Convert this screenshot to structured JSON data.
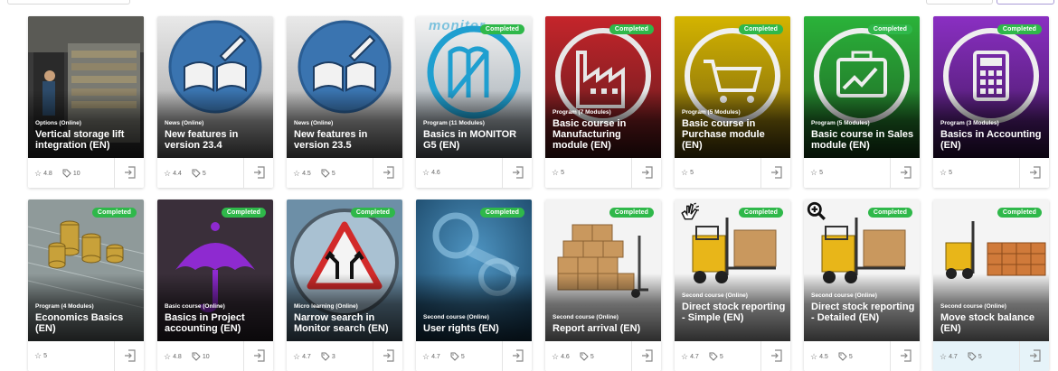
{
  "colors": {
    "completed_badge": "#2fb84a",
    "monitor_blue": "#2a6ba0"
  },
  "row1": [
    {
      "category": "Options (Online)",
      "title": "Vertical storage lift integration (EN)",
      "rating": "4.8",
      "tags": "10",
      "completed": "",
      "image": "warehouse-lift-photo"
    },
    {
      "category": "News (Online)",
      "title": "New features in version 23.4",
      "rating": "4.4",
      "tags": "5",
      "completed": "",
      "image": "open-book-icon"
    },
    {
      "category": "News (Online)",
      "title": "New features in version 23.5",
      "rating": "4.5",
      "tags": "5",
      "completed": "",
      "image": "open-book-icon"
    },
    {
      "category": "Program (11 Modules)",
      "title": "Basics in MONITOR G5 (EN)",
      "rating": "4.6",
      "tags": "",
      "completed": "Completed",
      "image": "monitor-logo-icon",
      "watermark": "monitor"
    },
    {
      "category": "Program (7 Modules)",
      "title": "Basic course in Manufacturing module (EN)",
      "rating": "5",
      "tags": "",
      "completed": "Completed",
      "image": "factory-icon"
    },
    {
      "category": "Program (5 Modules)",
      "title": "Basic course in Purchase module (EN)",
      "rating": "5",
      "tags": "",
      "completed": "Completed",
      "image": "shopping-cart-icon"
    },
    {
      "category": "Program (5 Modules)",
      "title": "Basic course in Sales module (EN)",
      "rating": "5",
      "tags": "",
      "completed": "Completed",
      "image": "briefcase-chart-icon"
    },
    {
      "category": "Program (3 Modules)",
      "title": "Basics in Accounting (EN)",
      "rating": "5",
      "tags": "",
      "completed": "Completed",
      "image": "calculator-icon"
    }
  ],
  "row2": [
    {
      "category": "Program (4 Modules)",
      "title": "Economics Basics (EN)",
      "rating": "5",
      "tags": "",
      "completed": "Completed",
      "image": "coins-photo"
    },
    {
      "category": "Basic course (Online)",
      "title": "Basics in Project accounting (EN)",
      "rating": "4.8",
      "tags": "10",
      "completed": "Completed",
      "image": "umbrella-icon"
    },
    {
      "category": "Micro learning (Online)",
      "title": "Narrow search in Monitor search (EN)",
      "rating": "4.7",
      "tags": "3",
      "completed": "Completed",
      "image": "road-sign-photo"
    },
    {
      "category": "Second course (Online)",
      "title": "User rights (EN)",
      "rating": "4.7",
      "tags": "5",
      "completed": "Completed",
      "image": "keys-photo"
    },
    {
      "category": "Second course (Online)",
      "title": "Report arrival (EN)",
      "rating": "4.6",
      "tags": "5",
      "completed": "Completed",
      "image": "boxes-trolley-photo"
    },
    {
      "category": "Second course (Online)",
      "title": "Direct stock reporting - Simple (EN)",
      "rating": "4.7",
      "tags": "5",
      "completed": "Completed",
      "image": "forklift-photo",
      "corner_icon": "peace-hand-icon"
    },
    {
      "category": "Second course (Online)",
      "title": "Direct stock reporting - Detailed (EN)",
      "rating": "4.5",
      "tags": "5",
      "completed": "Completed",
      "image": "forklift-photo",
      "corner_icon": "magnifier-plus-icon"
    },
    {
      "category": "Second course (Online)",
      "title": "Move stock balance (EN)",
      "rating": "4.7",
      "tags": "5",
      "completed": "Completed",
      "image": "warehouse-forklift-photo"
    }
  ]
}
